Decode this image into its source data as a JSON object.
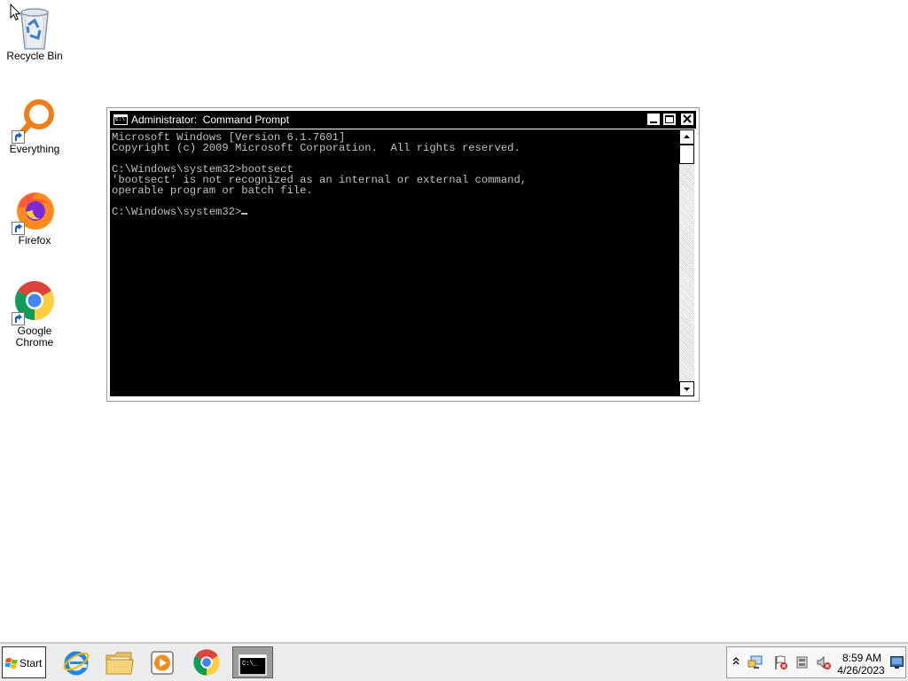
{
  "desktop": {
    "icons": [
      {
        "label": "Recycle Bin",
        "icon": "recycle-bin-icon"
      },
      {
        "label": "Everything",
        "icon": "everything-search-icon"
      },
      {
        "label": "Firefox",
        "icon": "firefox-icon"
      },
      {
        "label_line1": "Google",
        "label_line2": "Chrome",
        "icon": "chrome-icon"
      }
    ]
  },
  "console": {
    "title": "Administrator:  Command Prompt",
    "lines": [
      "Microsoft Windows [Version 6.1.7601]",
      "Copyright (c) 2009 Microsoft Corporation.  All rights reserved.",
      "",
      "C:\\Windows\\system32>bootsect",
      "'bootsect' is not recognized as an internal or external command,",
      "operable program or batch file.",
      ""
    ],
    "prompt": "C:\\Windows\\system32>",
    "colors": {
      "background": "#000000",
      "text": "#c0c0c0",
      "titlebar": "#000000"
    }
  },
  "taskbar": {
    "start_label": "Start",
    "pinned": [
      {
        "icon": "internet-explorer-icon"
      },
      {
        "icon": "file-explorer-icon"
      },
      {
        "icon": "media-player-icon"
      },
      {
        "icon": "chrome-icon"
      },
      {
        "icon": "command-prompt-icon",
        "active": true
      }
    ],
    "tray": {
      "icons": [
        "show-hidden-icons-icon",
        "network-icon",
        "action-center-flag-icon",
        "power-icon",
        "volume-muted-icon",
        "show-desktop-icon"
      ],
      "time": "8:59 AM",
      "date": "4/26/2023"
    }
  }
}
